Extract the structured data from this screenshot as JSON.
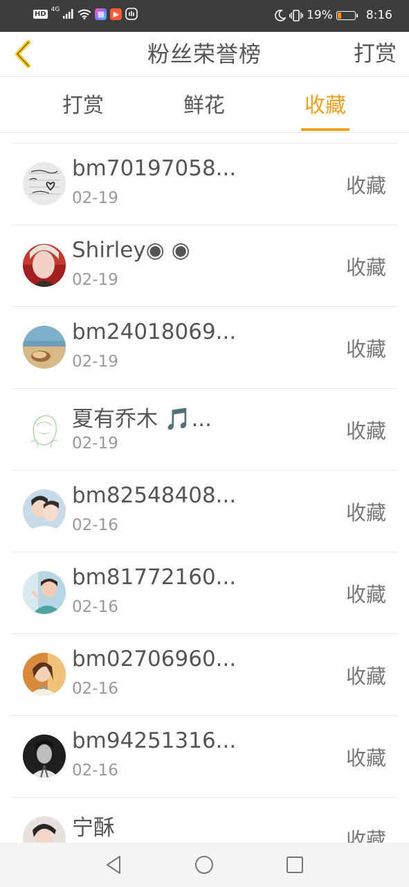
{
  "status_bar": {
    "hd": "HD",
    "network": "4G",
    "battery_percent_text": "19%",
    "battery_level": 0.19,
    "time": "8:16",
    "icons": [
      "signal-icon",
      "wifi-icon",
      "app-icon-1",
      "app-icon-2",
      "app-icon-3",
      "moon-icon",
      "vibrate-icon",
      "battery-icon"
    ]
  },
  "header": {
    "title": "粉丝荣誉榜",
    "action": "打赏",
    "back_icon": "chevron-left-icon",
    "accent": "#f0a11c"
  },
  "tabs": [
    {
      "label": "打赏",
      "active": false
    },
    {
      "label": "鲜花",
      "active": false
    },
    {
      "label": "收藏",
      "active": true
    }
  ],
  "list": [
    {
      "name": "bm70197058...",
      "date": "02-19",
      "type": "收藏"
    },
    {
      "name": "Shirley◉ ◉",
      "date": "02-19",
      "type": "收藏"
    },
    {
      "name": "bm24018069...",
      "date": "02-19",
      "type": "收藏"
    },
    {
      "name": "夏有乔木 🎵...",
      "date": "02-19",
      "type": "收藏"
    },
    {
      "name": "bm82548408...",
      "date": "02-16",
      "type": "收藏"
    },
    {
      "name": "bm81772160...",
      "date": "02-16",
      "type": "收藏"
    },
    {
      "name": "bm02706960...",
      "date": "02-16",
      "type": "收藏"
    },
    {
      "name": "bm94251316...",
      "date": "02-16",
      "type": "收藏"
    },
    {
      "name": "宁酥",
      "date": "",
      "type": "收藏"
    }
  ],
  "navbar": {
    "icons": [
      "back-triangle-icon",
      "home-circle-icon",
      "recents-square-icon"
    ]
  }
}
